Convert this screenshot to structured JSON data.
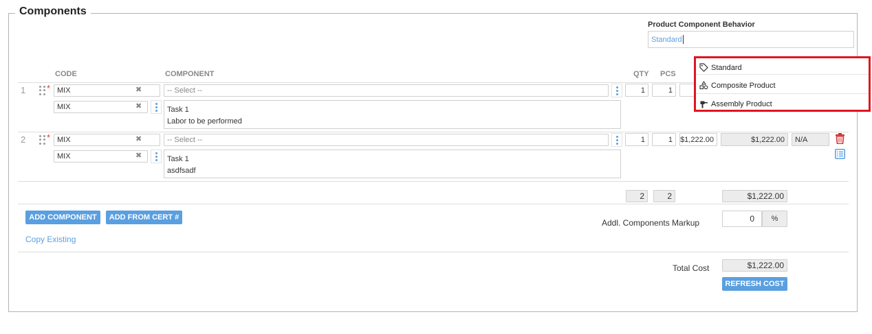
{
  "section": {
    "title": "Components"
  },
  "behavior": {
    "label": "Product Component Behavior",
    "value": "Standard",
    "options": [
      {
        "label": "Standard",
        "icon": "tag-icon"
      },
      {
        "label": "Composite Product",
        "icon": "shapes-icon"
      },
      {
        "label": "Assembly Product",
        "icon": "hammer-icon"
      }
    ]
  },
  "table": {
    "headers": {
      "code": "CODE",
      "component": "COMPONENT",
      "qty": "QTY",
      "pcs": "PCS"
    },
    "rows": [
      {
        "num": "1",
        "code": "MIX",
        "subcode": "MIX",
        "select": "-- Select --",
        "task": "Task 1",
        "desc": "Labor to be performed",
        "qty": "1",
        "pcs": "1"
      },
      {
        "num": "2",
        "code": "MIX",
        "subcode": "MIX",
        "select": "-- Select --",
        "task": "Task 1",
        "desc": "asdfsadf",
        "qty": "1",
        "pcs": "1",
        "price": "$1,222.00",
        "total": "$1,222.00",
        "na": "N/A"
      }
    ],
    "totals": {
      "qty": "2",
      "pcs": "2",
      "amount": "$1,222.00"
    }
  },
  "actions": {
    "add_component": "ADD COMPONENT",
    "add_from_cert": "ADD FROM CERT #",
    "copy_existing": "Copy Existing"
  },
  "markup": {
    "label": "Addl. Components Markup",
    "value": "0",
    "unit": "%"
  },
  "total_cost": {
    "label": "Total Cost",
    "value": "$1,222.00",
    "refresh": "REFRESH COST"
  },
  "colors": {
    "accent": "#5a9fe0",
    "danger": "#d33030",
    "highlight": "#e0141e"
  }
}
